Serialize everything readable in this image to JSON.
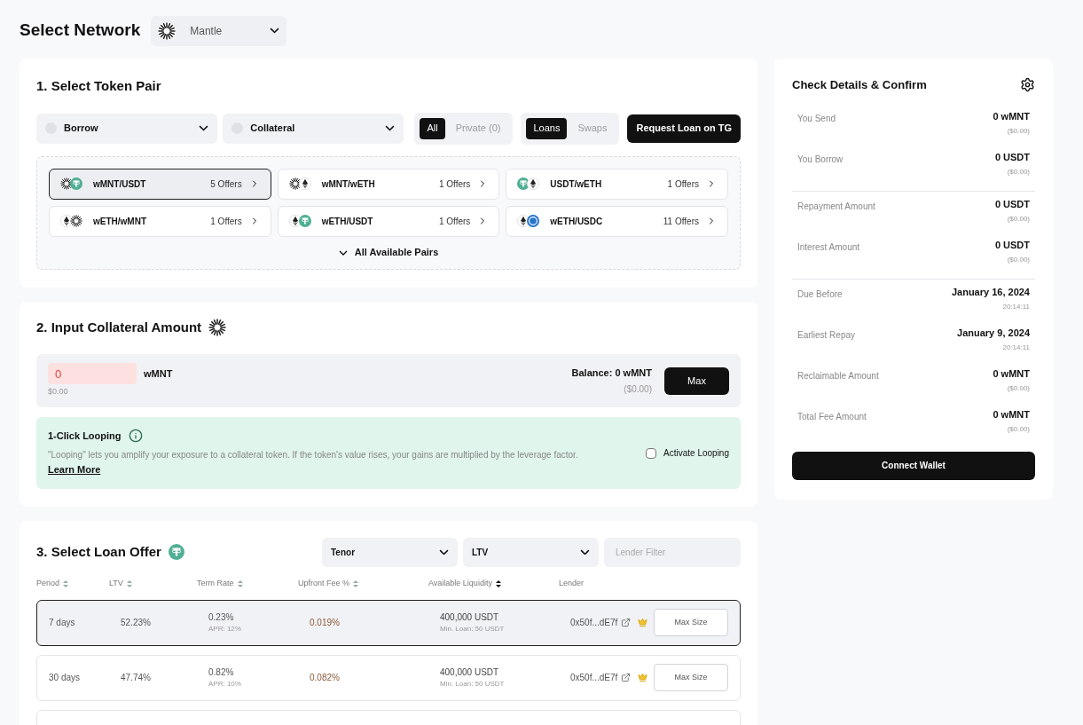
{
  "network": {
    "title": "Select Network",
    "selected": "Mantle",
    "icon": {
      "kind": "mnt"
    }
  },
  "pair_section": {
    "title": "1. Select Token Pair",
    "selects": [
      {
        "label": "Borrow"
      },
      {
        "label": "Collateral"
      }
    ],
    "visibility_tabs": [
      {
        "label": "All",
        "selected": true
      },
      {
        "label": "Private (0)",
        "selected": false
      }
    ],
    "type_tabs": [
      {
        "label": "Loans",
        "selected": true
      },
      {
        "label": "Swaps",
        "selected": false
      }
    ],
    "request_button": "Request Loan on TG",
    "pairs": [
      {
        "label": "wMNT/USDT",
        "offers": "5 Offers",
        "selected": true,
        "tokens": [
          {
            "kind": "mnt"
          },
          {
            "kind": "usdt"
          }
        ]
      },
      {
        "label": "wMNT/wETH",
        "offers": "1 Offers",
        "selected": false,
        "tokens": [
          {
            "kind": "mnt"
          },
          {
            "kind": "eth"
          }
        ]
      },
      {
        "label": "USDT/wETH",
        "offers": "1 Offers",
        "selected": false,
        "tokens": [
          {
            "kind": "usdt"
          },
          {
            "kind": "eth"
          }
        ]
      },
      {
        "label": "wETH/wMNT",
        "offers": "1 Offers",
        "selected": false,
        "tokens": [
          {
            "kind": "eth"
          },
          {
            "kind": "mnt"
          }
        ]
      },
      {
        "label": "wETH/USDT",
        "offers": "1 Offers",
        "selected": false,
        "tokens": [
          {
            "kind": "eth"
          },
          {
            "kind": "usdt"
          }
        ]
      },
      {
        "label": "wETH/USDC",
        "offers": "11 Offers",
        "selected": false,
        "tokens": [
          {
            "kind": "eth"
          },
          {
            "kind": "usdc"
          }
        ]
      }
    ],
    "more": "All Available Pairs"
  },
  "collateral_section": {
    "title": "2. Input Collateral Amount",
    "icon": {
      "kind": "mnt"
    },
    "amount": "0",
    "token": "wMNT",
    "amount_usd": "$0.00",
    "balance": "Balance: 0 wMNT",
    "balance_usd": "($0.00)",
    "max_button": "Max",
    "looping": {
      "title": "1-Click Looping",
      "text": "\"Looping\" lets you amplify your exposure to a collateral token. If the token's value rises, your gains are multiplied by the leverage factor.",
      "link": "Learn More",
      "checkbox": "Activate Looping",
      "checked": false
    }
  },
  "offer_section": {
    "title": "3. Select Loan Offer",
    "icon": {
      "kind": "usdt"
    },
    "filters": [
      {
        "label": "Tenor"
      },
      {
        "label": "LTV"
      }
    ],
    "lender_filter": {
      "placeholder": "Lender Filter"
    },
    "columns": [
      {
        "label": "Period",
        "kind": "sortable"
      },
      {
        "label": "LTV",
        "kind": "sortable"
      },
      {
        "label": "Term Rate",
        "kind": "sortable"
      },
      {
        "label": "Upfront Fee %",
        "kind": "sortable"
      },
      {
        "label": "Available Liquidity",
        "kind": "sorted"
      },
      {
        "label": "Lender",
        "kind": "plain"
      }
    ],
    "rows": [
      {
        "period": "7 days",
        "ltv": "52.23%",
        "term_rate": "0.23%",
        "apr": "APR: 12%",
        "fee": "0.019%",
        "liquidity": "400,000 USDT",
        "min_loan": "Min. Loan: 50 USDT",
        "lender": "0x50f...dE7f",
        "button": "Max Size",
        "selected": true
      },
      {
        "period": "30 days",
        "ltv": "47.74%",
        "term_rate": "0.82%",
        "apr": "APR: 10%",
        "fee": "0.082%",
        "liquidity": "400,000 USDT",
        "min_loan": "Min. Loan: 50 USDT",
        "lender": "0x50f...dE7f",
        "button": "Max Size",
        "selected": false
      }
    ]
  },
  "summary": {
    "title": "Check Details & Confirm",
    "groups": [
      [
        {
          "label": "You Send",
          "value": "0 wMNT",
          "sub": "($0.00)"
        },
        {
          "label": "You Borrow",
          "value": "0 USDT",
          "sub": "($0.00)"
        }
      ],
      [
        {
          "label": "Repayment Amount",
          "value": "0 USDT",
          "sub": "($0.00)"
        },
        {
          "label": "Interest Amount",
          "value": "0 USDT",
          "sub": "($0.00)"
        }
      ],
      [
        {
          "label": "Due Before",
          "value": "January 16, 2024",
          "sub": "20:14:11"
        },
        {
          "label": "Earliest Repay",
          "value": "January 9, 2024",
          "sub": "20:14:11"
        },
        {
          "label": "Reclaimable Amount",
          "value": "0 wMNT",
          "sub": "($0.00)"
        },
        {
          "label": "Total Fee Amount",
          "value": "0 wMNT",
          "sub": "($0.00)"
        }
      ]
    ],
    "button": "Connect Wallet"
  }
}
